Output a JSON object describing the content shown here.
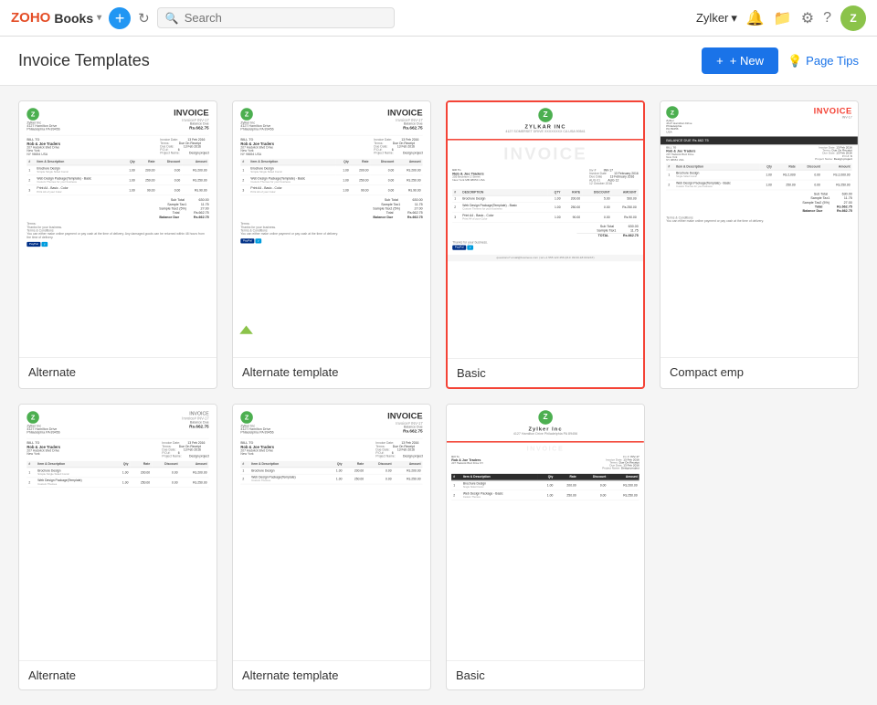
{
  "app": {
    "name": "ZOHO",
    "product": "Books",
    "user": "Zylker"
  },
  "header": {
    "title": "Invoice Templates",
    "new_label": "+ New",
    "page_tips_label": "Page Tips",
    "search_placeholder": "Search"
  },
  "templates": [
    {
      "id": "alternate",
      "label": "Alternate",
      "selected": false,
      "row": 1
    },
    {
      "id": "alternate-template",
      "label": "Alternate template",
      "selected": false,
      "row": 1
    },
    {
      "id": "basic",
      "label": "Basic",
      "selected": true,
      "row": 1
    },
    {
      "id": "compact-emp",
      "label": "Compact emp",
      "selected": false,
      "row": 1
    },
    {
      "id": "alternate-2",
      "label": "Alternate",
      "selected": false,
      "row": 2
    },
    {
      "id": "alternate-template-2",
      "label": "Alternate template",
      "selected": false,
      "row": 2
    },
    {
      "id": "basic-2",
      "label": "Basic",
      "selected": false,
      "row": 2
    }
  ],
  "invoice_data": {
    "company": "Zylker Inc",
    "address": "4127 Hamilton Drive\nPhiladelphia\nPA 89456",
    "invoice_number": "INV-17",
    "balance_due_label": "Balance Due",
    "amount": "Rs.662.75",
    "bill_to": "Rob & Joe Traders",
    "bill_to_address": "207 Hadwick Blvd Drive\nNew York\nNY 98654 USA",
    "invoice_date_label": "Invoice Date",
    "invoice_date": "13 Feb 2016",
    "terms_label": "Terms",
    "terms": "Due On Receipt",
    "due_date_label": "Due Date",
    "due_date": "13 Feb 2016",
    "po_label": "P.O.#",
    "po": "6",
    "project_label": "Project Name",
    "project": "Design project",
    "items": [
      {
        "name": "Brochure Design",
        "desc": "Simple Single Sided Comic",
        "qty": "1.00",
        "rate": "200.00",
        "discount": "0.00",
        "amount": "Rs.200.00"
      },
      {
        "name": "Web Design Package(Template) - Basic",
        "desc": "Custom Themes for your business. Inclusive of",
        "qty": "1.00",
        "rate": "250.00",
        "discount": "0.00",
        "amount": "Rs.250.00"
      },
      {
        "name": "Print A4 - Basic - Color",
        "desc": "Print A4 of your Color",
        "qty": "1.00",
        "rate": "90.00",
        "discount": "0.00",
        "amount": "Rs.90.00"
      }
    ],
    "sub_total": "630.00",
    "tax1": "14.75",
    "total": "Rs.662.75",
    "balance_due": "Rs.662.75"
  },
  "nav": {
    "icons": {
      "plus": "+",
      "refresh": "↻",
      "search": "🔍",
      "bell": "🔔",
      "folder": "📁",
      "gear": "⚙",
      "help": "?",
      "chevron_down": "▾",
      "lightbulb": "💡"
    }
  }
}
